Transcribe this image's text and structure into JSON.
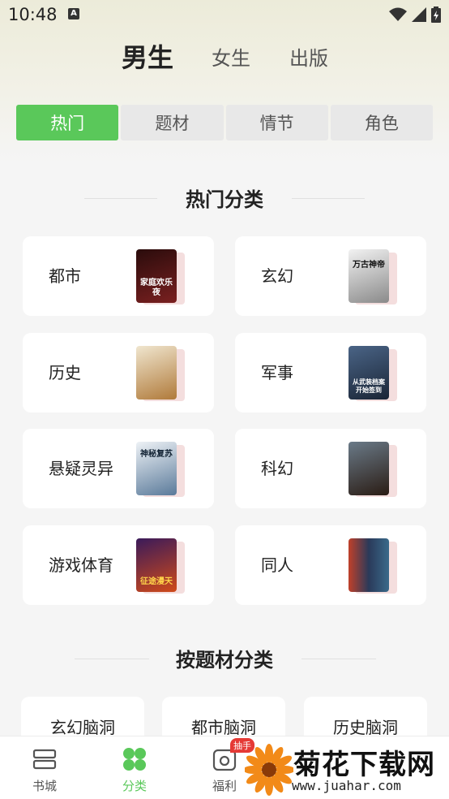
{
  "status": {
    "time": "10:48",
    "notification_letter": "A"
  },
  "gender_tabs": [
    {
      "label": "男生",
      "active": true
    },
    {
      "label": "女生",
      "active": false
    },
    {
      "label": "出版",
      "active": false
    }
  ],
  "segments": [
    {
      "label": "热门",
      "active": true
    },
    {
      "label": "题材",
      "active": false
    },
    {
      "label": "情节",
      "active": false
    },
    {
      "label": "角色",
      "active": false
    }
  ],
  "hot_section": {
    "title": "热门分类",
    "categories": [
      {
        "label": "都市",
        "cover_text": "家庭欢乐夜",
        "cover_color": "#5a1a1a"
      },
      {
        "label": "玄幻",
        "cover_text": "万古神帝",
        "cover_color": "#1c1c1c"
      },
      {
        "label": "历史",
        "cover_text": "",
        "cover_color": "#c9a26b"
      },
      {
        "label": "军事",
        "cover_text": "从武装档案开始签到",
        "cover_color": "#2b3e5c"
      },
      {
        "label": "悬疑灵异",
        "cover_text": "神秘复苏",
        "cover_color": "#5a7a9a"
      },
      {
        "label": "科幻",
        "cover_text": "",
        "cover_color": "#3b2a20"
      },
      {
        "label": "游戏体育",
        "cover_text": "征途漫天",
        "cover_color": "#7a1e2a"
      },
      {
        "label": "同人",
        "cover_text": "",
        "cover_color": "#3a4a66"
      }
    ]
  },
  "topic_section": {
    "title": "按题材分类",
    "items": [
      "玄幻脑洞",
      "都市脑洞",
      "历史脑洞"
    ]
  },
  "bottom_nav": [
    {
      "label": "书城",
      "icon": "bookshelf-icon",
      "active": false
    },
    {
      "label": "分类",
      "icon": "category-icon",
      "active": true
    },
    {
      "label": "福利",
      "icon": "gift-icon",
      "active": false,
      "badge": "抽手"
    }
  ],
  "watermark": {
    "title": "菊花下载网",
    "url": "www.juahar.com"
  },
  "colors": {
    "accent": "#5ac85a",
    "badge": "#e53935"
  }
}
